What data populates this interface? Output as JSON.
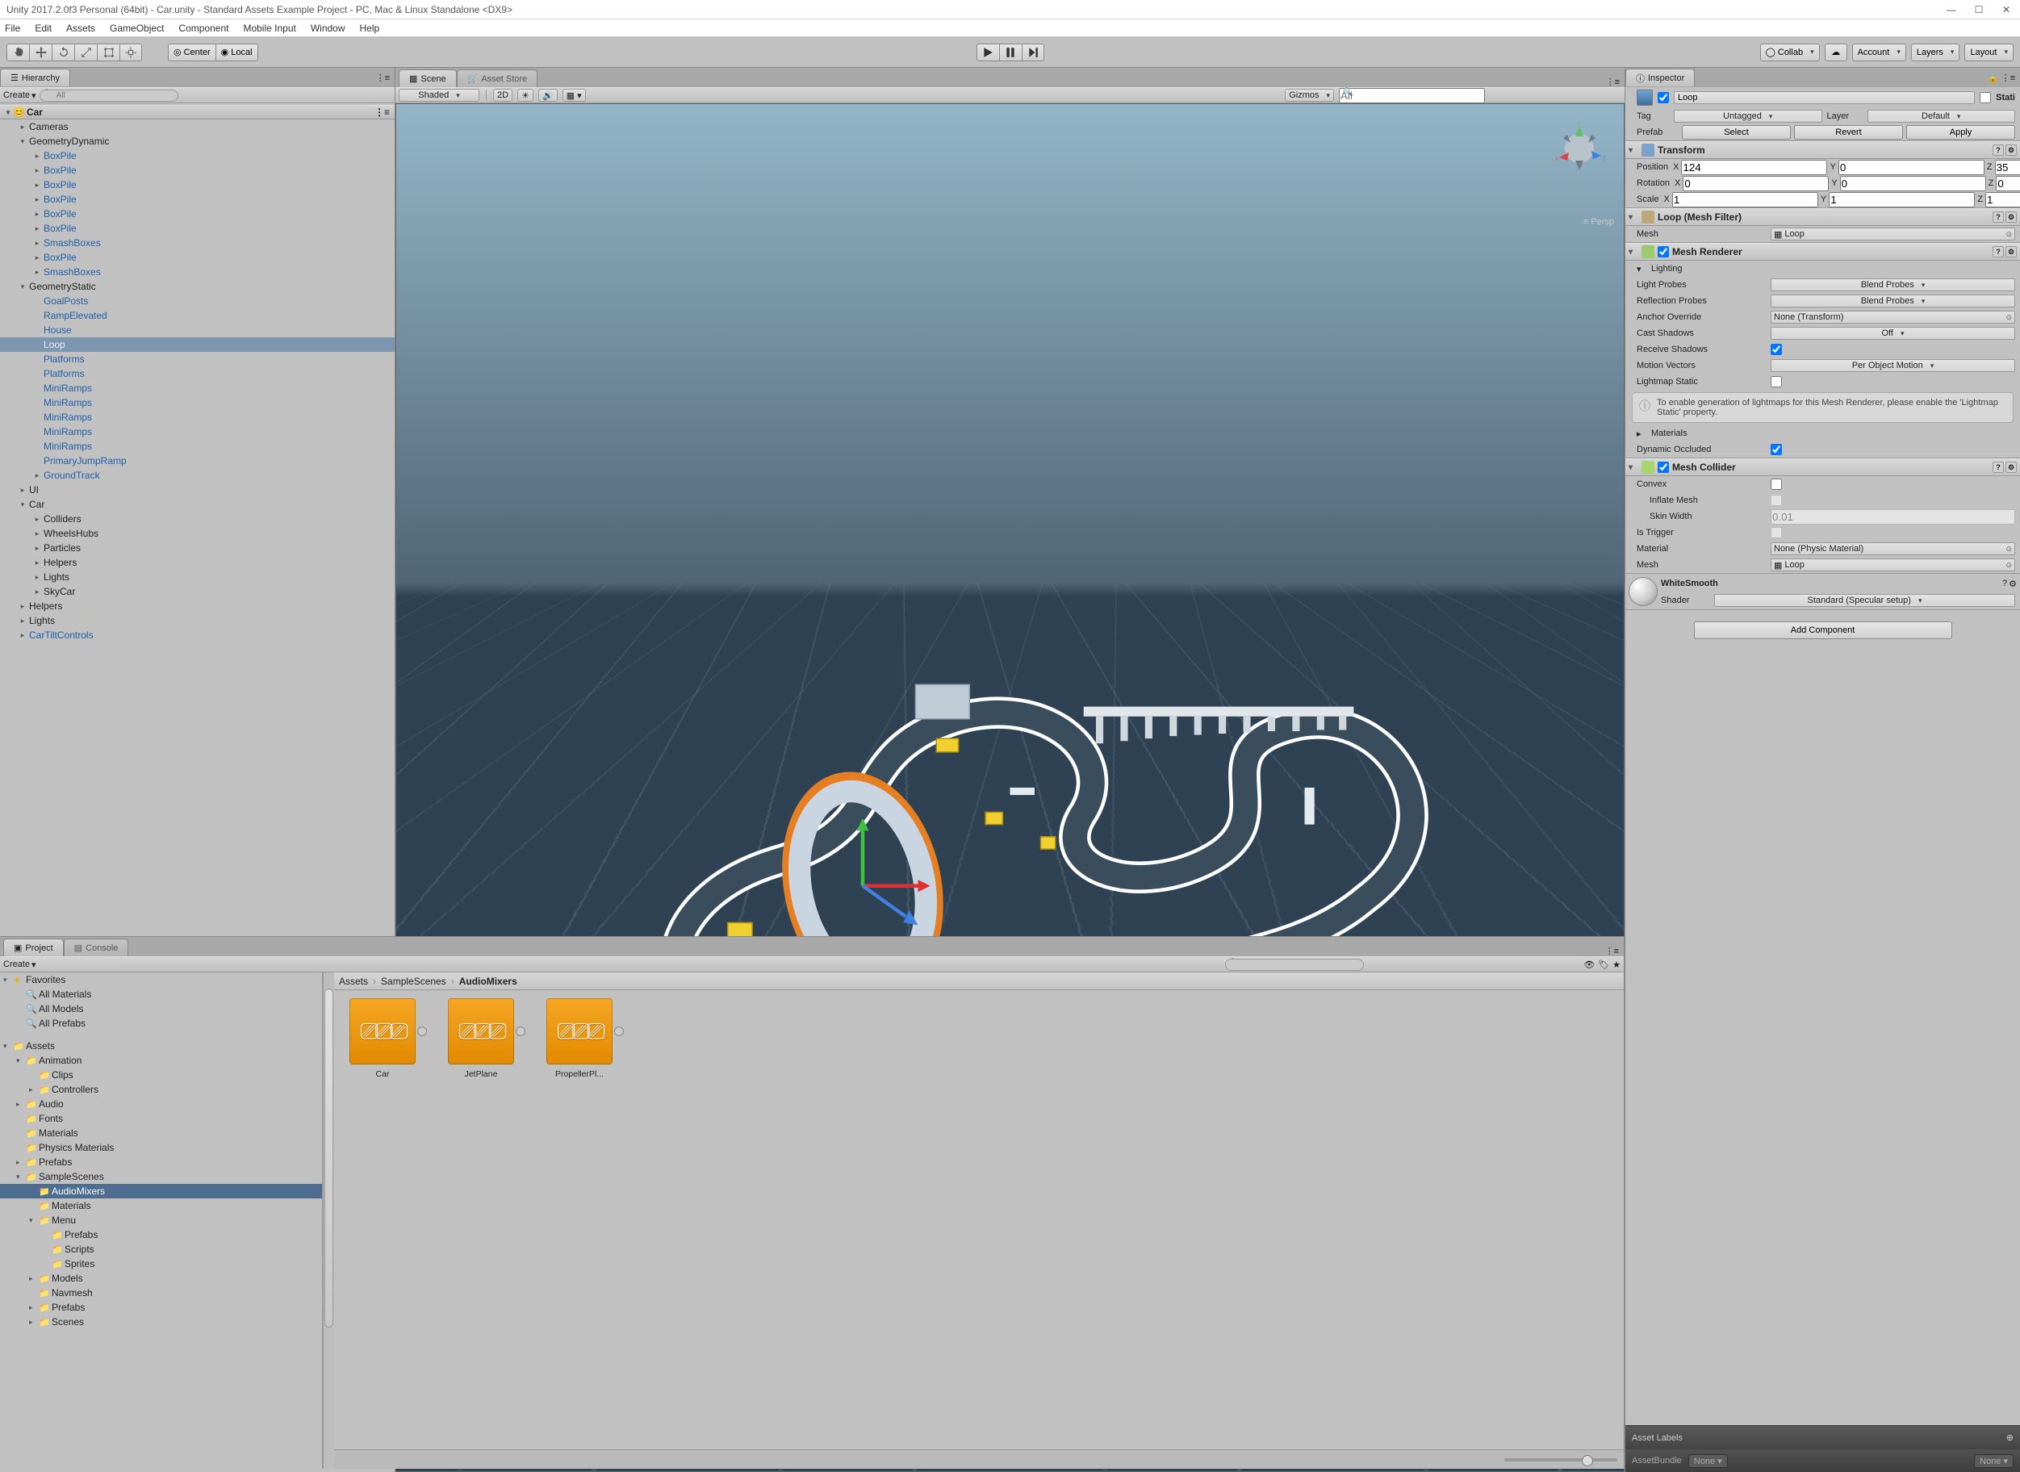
{
  "titlebar": "Unity 2017.2.0f3 Personal (64bit) - Car.unity - Standard Assets Example Project - PC, Mac & Linux Standalone <DX9>",
  "menubar": [
    "File",
    "Edit",
    "Assets",
    "GameObject",
    "Component",
    "Mobile Input",
    "Window",
    "Help"
  ],
  "toolbar": {
    "center": "Center",
    "local": "Local",
    "collab": "Collab",
    "account": "Account",
    "layers": "Layers",
    "layout": "Layout"
  },
  "hierarchy": {
    "title": "Hierarchy",
    "create": "Create",
    "search_placeholder": "All",
    "scene": "Car",
    "nodes": [
      {
        "l": 1,
        "a": "▸",
        "t": "Cameras",
        "p": false
      },
      {
        "l": 1,
        "a": "▾",
        "t": "GeometryDynamic",
        "p": false
      },
      {
        "l": 2,
        "a": "▸",
        "t": "BoxPile",
        "p": true
      },
      {
        "l": 2,
        "a": "▸",
        "t": "BoxPile",
        "p": true
      },
      {
        "l": 2,
        "a": "▸",
        "t": "BoxPile",
        "p": true
      },
      {
        "l": 2,
        "a": "▸",
        "t": "BoxPile",
        "p": true
      },
      {
        "l": 2,
        "a": "▸",
        "t": "BoxPile",
        "p": true
      },
      {
        "l": 2,
        "a": "▸",
        "t": "BoxPile",
        "p": true
      },
      {
        "l": 2,
        "a": "▸",
        "t": "SmashBoxes",
        "p": true
      },
      {
        "l": 2,
        "a": "▸",
        "t": "BoxPile",
        "p": true
      },
      {
        "l": 2,
        "a": "▸",
        "t": "SmashBoxes",
        "p": true
      },
      {
        "l": 1,
        "a": "▾",
        "t": "GeometryStatic",
        "p": false
      },
      {
        "l": 2,
        "a": "",
        "t": "GoalPosts",
        "p": true
      },
      {
        "l": 2,
        "a": "",
        "t": "RampElevated",
        "p": true
      },
      {
        "l": 2,
        "a": "",
        "t": "House",
        "p": true
      },
      {
        "l": 2,
        "a": "",
        "t": "Loop",
        "p": true,
        "sel": true
      },
      {
        "l": 2,
        "a": "",
        "t": "Platforms",
        "p": true
      },
      {
        "l": 2,
        "a": "",
        "t": "Platforms",
        "p": true
      },
      {
        "l": 2,
        "a": "",
        "t": "MiniRamps",
        "p": true
      },
      {
        "l": 2,
        "a": "",
        "t": "MiniRamps",
        "p": true
      },
      {
        "l": 2,
        "a": "",
        "t": "MiniRamps",
        "p": true
      },
      {
        "l": 2,
        "a": "",
        "t": "MiniRamps",
        "p": true
      },
      {
        "l": 2,
        "a": "",
        "t": "MiniRamps",
        "p": true
      },
      {
        "l": 2,
        "a": "",
        "t": "PrimaryJumpRamp",
        "p": true
      },
      {
        "l": 2,
        "a": "▸",
        "t": "GroundTrack",
        "p": true
      },
      {
        "l": 1,
        "a": "▸",
        "t": "UI",
        "p": false
      },
      {
        "l": 1,
        "a": "▾",
        "t": "Car",
        "p": false
      },
      {
        "l": 2,
        "a": "▸",
        "t": "Colliders",
        "p": false
      },
      {
        "l": 2,
        "a": "▸",
        "t": "WheelsHubs",
        "p": false
      },
      {
        "l": 2,
        "a": "▸",
        "t": "Particles",
        "p": false
      },
      {
        "l": 2,
        "a": "▸",
        "t": "Helpers",
        "p": false
      },
      {
        "l": 2,
        "a": "▸",
        "t": "Lights",
        "p": false
      },
      {
        "l": 2,
        "a": "▸",
        "t": "SkyCar",
        "p": false
      },
      {
        "l": 1,
        "a": "▸",
        "t": "Helpers",
        "p": false
      },
      {
        "l": 1,
        "a": "▸",
        "t": "Lights",
        "p": false
      },
      {
        "l": 1,
        "a": "▸",
        "t": "CarTiltControls",
        "p": true
      }
    ]
  },
  "scene": {
    "tab_scene": "Scene",
    "tab_asset": "Asset Store",
    "shaded": "Shaded",
    "twod": "2D",
    "gizmos": "Gizmos",
    "persp": "Persp",
    "search_placeholder": "All"
  },
  "inspector": {
    "title": "Inspector",
    "object": {
      "name": "Loop",
      "static": "Stati"
    },
    "tag": {
      "label": "Tag",
      "value": "Untagged"
    },
    "layer": {
      "label": "Layer",
      "value": "Default"
    },
    "prefab": {
      "label": "Prefab",
      "select": "Select",
      "revert": "Revert",
      "apply": "Apply"
    },
    "transform": {
      "title": "Transform",
      "position": {
        "label": "Position",
        "x": "124",
        "y": "0",
        "z": "35"
      },
      "rotation": {
        "label": "Rotation",
        "x": "0",
        "y": "0",
        "z": "0"
      },
      "scale": {
        "label": "Scale",
        "x": "1",
        "y": "1",
        "z": "1"
      }
    },
    "meshfilter": {
      "title": "Loop (Mesh Filter)",
      "mesh_label": "Mesh",
      "mesh_value": "Loop"
    },
    "meshrenderer": {
      "title": "Mesh Renderer",
      "lighting": "Lighting",
      "light_probes": {
        "label": "Light Probes",
        "value": "Blend Probes"
      },
      "reflection_probes": {
        "label": "Reflection Probes",
        "value": "Blend Probes"
      },
      "anchor_override": {
        "label": "Anchor Override",
        "value": "None (Transform)"
      },
      "cast_shadows": {
        "label": "Cast Shadows",
        "value": "Off"
      },
      "receive_shadows": {
        "label": "Receive Shadows",
        "value": true
      },
      "motion_vectors": {
        "label": "Motion Vectors",
        "value": "Per Object Motion"
      },
      "lightmap_static": {
        "label": "Lightmap Static",
        "value": false
      },
      "info": "To enable generation of lightmaps for this Mesh Renderer, please enable the 'Lightmap Static' property.",
      "materials": "Materials",
      "dynamic_occluded": {
        "label": "Dynamic Occluded",
        "value": true
      }
    },
    "meshcollider": {
      "title": "Mesh Collider",
      "convex": {
        "label": "Convex",
        "value": false
      },
      "inflate": {
        "label": "Inflate Mesh",
        "value": false
      },
      "skin_width": {
        "label": "Skin Width",
        "value": "0.01"
      },
      "is_trigger": {
        "label": "Is Trigger",
        "value": false
      },
      "material": {
        "label": "Material",
        "value": "None (Physic Material)"
      },
      "mesh": {
        "label": "Mesh",
        "value": "Loop"
      }
    },
    "material": {
      "name": "WhiteSmooth",
      "shader_label": "Shader",
      "shader_value": "Standard (Specular setup)"
    },
    "add_component": "Add Component",
    "asset_labels": "Asset Labels",
    "assetbundle_label": "AssetBundle",
    "assetbundle_value": "None",
    "assetbundle_variant": "None"
  },
  "project": {
    "tab_project": "Project",
    "tab_console": "Console",
    "create": "Create",
    "favorites": {
      "header": "Favorites",
      "items": [
        "All Materials",
        "All Models",
        "All Prefabs"
      ]
    },
    "assets": {
      "header": "Assets",
      "items": [
        {
          "l": 1,
          "a": "▾",
          "t": "Animation"
        },
        {
          "l": 2,
          "a": "",
          "t": "Clips"
        },
        {
          "l": 2,
          "a": "▸",
          "t": "Controllers"
        },
        {
          "l": 1,
          "a": "▸",
          "t": "Audio"
        },
        {
          "l": 1,
          "a": "",
          "t": "Fonts"
        },
        {
          "l": 1,
          "a": "",
          "t": "Materials"
        },
        {
          "l": 1,
          "a": "",
          "t": "Physics Materials"
        },
        {
          "l": 1,
          "a": "▸",
          "t": "Prefabs"
        },
        {
          "l": 1,
          "a": "▾",
          "t": "SampleScenes"
        },
        {
          "l": 2,
          "a": "",
          "t": "AudioMixers",
          "sel": true
        },
        {
          "l": 2,
          "a": "",
          "t": "Materials"
        },
        {
          "l": 2,
          "a": "▾",
          "t": "Menu"
        },
        {
          "l": 3,
          "a": "",
          "t": "Prefabs"
        },
        {
          "l": 3,
          "a": "",
          "t": "Scripts"
        },
        {
          "l": 3,
          "a": "",
          "t": "Sprites"
        },
        {
          "l": 2,
          "a": "▸",
          "t": "Models"
        },
        {
          "l": 2,
          "a": "",
          "t": "Navmesh"
        },
        {
          "l": 2,
          "a": "▸",
          "t": "Prefabs"
        },
        {
          "l": 2,
          "a": "▸",
          "t": "Scenes"
        }
      ]
    },
    "breadcrumb": [
      "Assets",
      "SampleScenes",
      "AudioMixers"
    ],
    "files": [
      "Car",
      "JetPlane",
      "PropellerPl..."
    ]
  }
}
